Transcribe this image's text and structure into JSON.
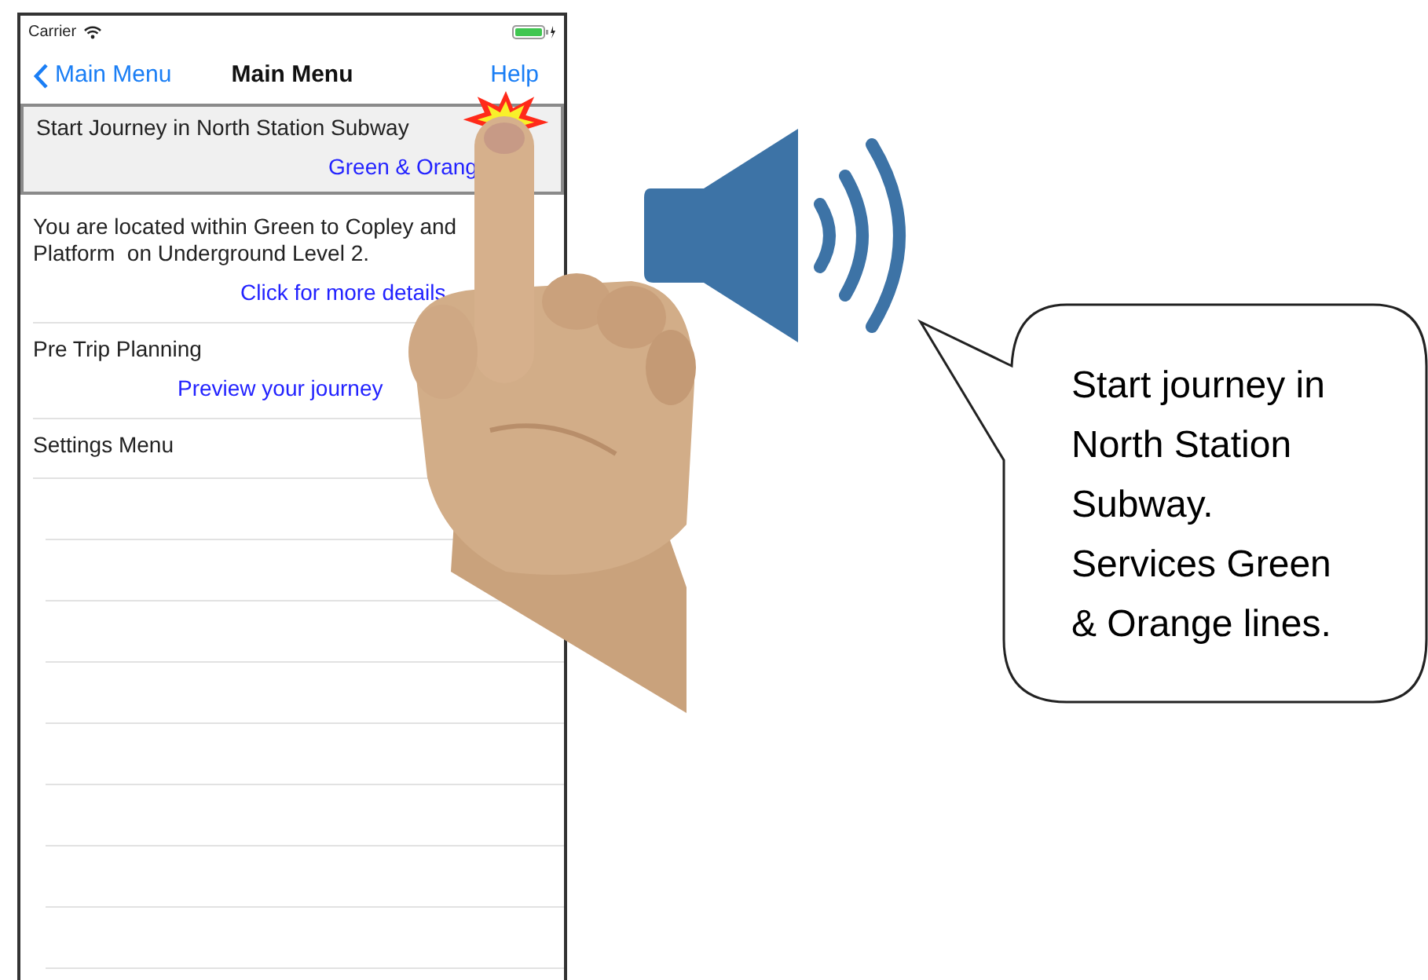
{
  "status_bar": {
    "carrier": "Carrier"
  },
  "nav": {
    "back": "Main Menu",
    "title": "Main Menu",
    "action": "Help"
  },
  "rows": [
    {
      "title": "Start Journey in North Station Subway",
      "detail": "Green & Orang",
      "selected": true
    },
    {
      "title": "You are located within Green to Copley and\nPlatform  on Underground Level 2.",
      "detail": "Click for more details",
      "selected": false
    },
    {
      "title": "Pre Trip Planning",
      "detail": "Preview your journey",
      "selected": false
    },
    {
      "title": "Settings Menu",
      "selected": false
    }
  ],
  "speech_bubble": {
    "lines": [
      "Start journey in",
      "North Station",
      "Subway.",
      "Services Green",
      "& Orange lines."
    ]
  }
}
